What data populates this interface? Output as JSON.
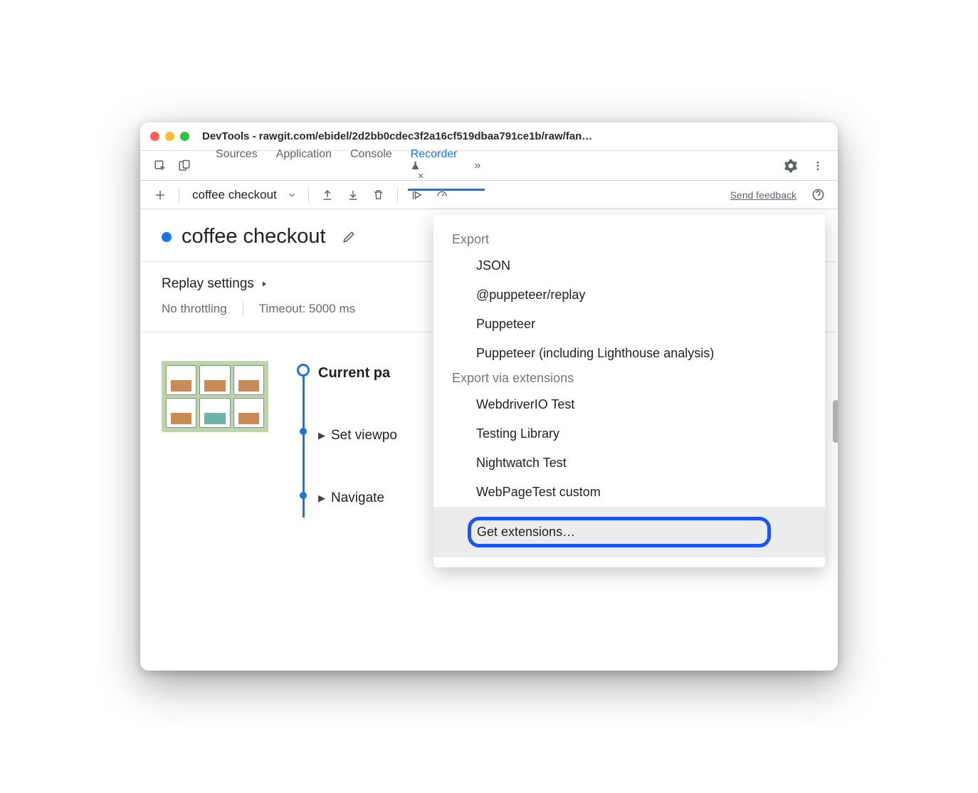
{
  "window": {
    "title": "DevTools - rawgit.com/ebidel/2d2bb0cdec3f2a16cf519dbaa791ce1b/raw/fan…"
  },
  "tabs": {
    "items": [
      "Sources",
      "Application",
      "Console",
      "Recorder"
    ],
    "active_close": "×",
    "overflow": "»"
  },
  "toolbar": {
    "recording_name": "coffee checkout",
    "feedback": "Send feedback"
  },
  "header": {
    "title": "coffee checkout"
  },
  "settings": {
    "title": "Replay settings",
    "throttling": "No throttling",
    "timeout": "Timeout: 5000 ms"
  },
  "steps": {
    "current": "Current pa",
    "items": [
      "Set viewpo",
      "Navigate"
    ]
  },
  "dropdown": {
    "section1": "Export",
    "group1": [
      "JSON",
      "@puppeteer/replay",
      "Puppeteer",
      "Puppeteer (including Lighthouse analysis)"
    ],
    "section2": "Export via extensions",
    "group2": [
      "WebdriverIO Test",
      "Testing Library",
      "Nightwatch Test",
      "WebPageTest custom"
    ],
    "get_ext": "Get extensions…"
  }
}
